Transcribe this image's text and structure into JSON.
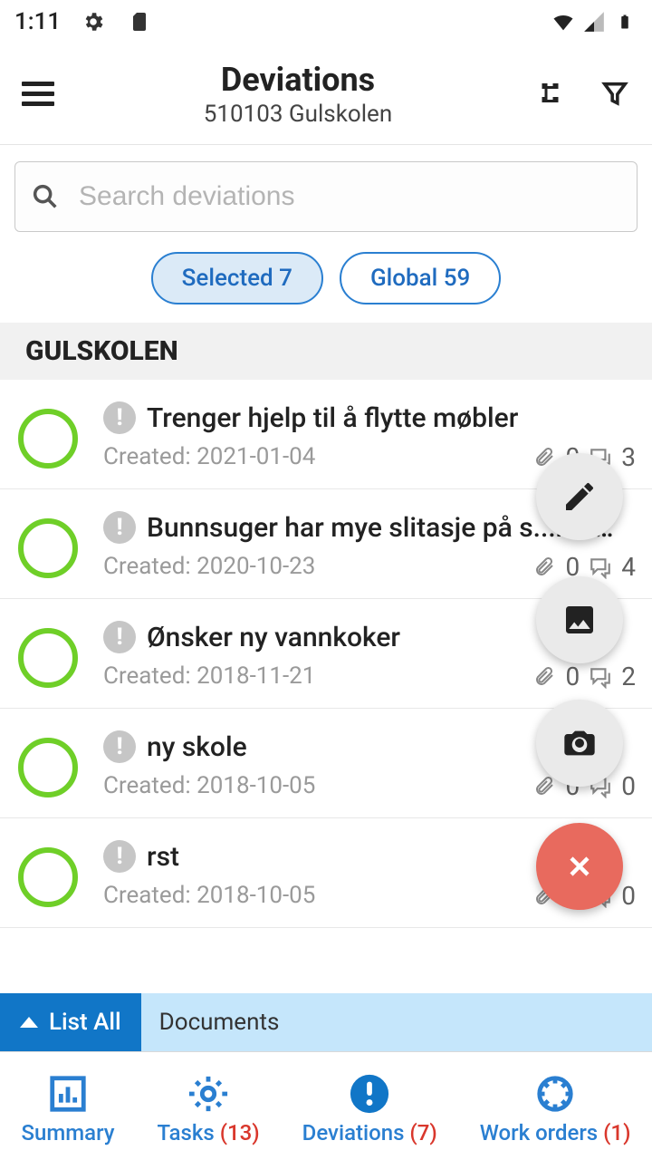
{
  "status": {
    "time": "1:11"
  },
  "header": {
    "title": "Deviations",
    "subtitle": "510103 Gulskolen"
  },
  "search": {
    "placeholder": "Search deviations"
  },
  "chips": {
    "selected": "Selected 7",
    "global": "Global 59"
  },
  "section": "GULSKOLEN",
  "items": [
    {
      "title": "Trenger hjelp til å flytte møbler",
      "created": "Created: 2021-01-04",
      "attach": "0",
      "comments": "3"
    },
    {
      "title": "Bunnsuger har mye slitasje på s...rull…",
      "created": "Created: 2020-10-23",
      "attach": "0",
      "comments": "4"
    },
    {
      "title": "Ønsker ny vannkoker",
      "created": "Created: 2018-11-21",
      "attach": "0",
      "comments": "2"
    },
    {
      "title": "ny skole",
      "created": "Created: 2018-10-05",
      "attach": "0",
      "comments": "0"
    },
    {
      "title": "rst",
      "created": "Created: 2018-10-05",
      "attach": "0",
      "comments": "0"
    }
  ],
  "strip": {
    "listAll": "List All",
    "documents": "Documents"
  },
  "nav": {
    "summary": "Summary",
    "tasks": "Tasks ",
    "tasksCount": "(13)",
    "deviations": "Deviations ",
    "deviationsCount": "(7)",
    "workorders": "Work orders ",
    "workordersCount": "(1)"
  }
}
